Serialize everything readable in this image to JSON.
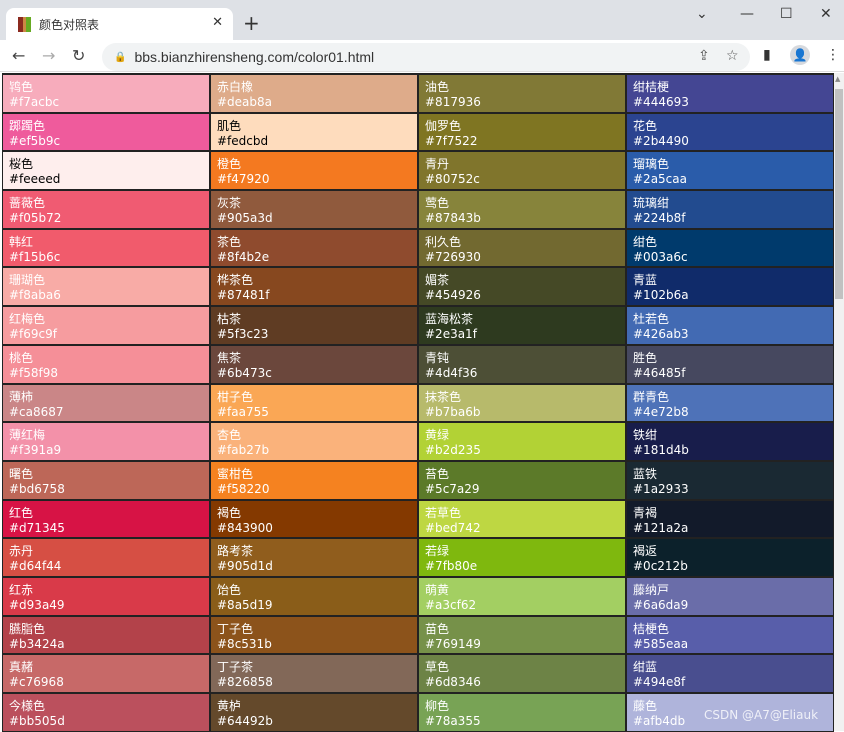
{
  "browser": {
    "tab_title": "颜色对照表",
    "url": "bbs.bianzhirensheng.com/color01.html"
  },
  "watermark": "CSDN @A7@Eliauk",
  "rows": [
    [
      {
        "name": "鸨色",
        "hex": "#f7acbc"
      },
      {
        "name": "赤白橡",
        "hex": "#deab8a"
      },
      {
        "name": "油色",
        "hex": "#817936"
      },
      {
        "name": "绀桔梗",
        "hex": "#444693"
      }
    ],
    [
      {
        "name": "踯躅色",
        "hex": "#ef5b9c"
      },
      {
        "name": "肌色",
        "hex": "#fedcbd"
      },
      {
        "name": "伽罗色",
        "hex": "#7f7522"
      },
      {
        "name": "花色",
        "hex": "#2b4490"
      }
    ],
    [
      {
        "name": "桜色",
        "hex": "#feeeed"
      },
      {
        "name": "橙色",
        "hex": "#f47920"
      },
      {
        "name": "青丹",
        "hex": "#80752c"
      },
      {
        "name": "瑠璃色",
        "hex": "#2a5caa"
      }
    ],
    [
      {
        "name": "蔷薇色",
        "hex": "#f05b72"
      },
      {
        "name": "灰茶",
        "hex": "#905a3d"
      },
      {
        "name": "莺色",
        "hex": "#87843b"
      },
      {
        "name": "琉璃绀",
        "hex": "#224b8f"
      }
    ],
    [
      {
        "name": "韩红",
        "hex": "#f15b6c"
      },
      {
        "name": "茶色",
        "hex": "#8f4b2e"
      },
      {
        "name": "利久色",
        "hex": "#726930"
      },
      {
        "name": "绀色",
        "hex": "#003a6c"
      }
    ],
    [
      {
        "name": "珊瑚色",
        "hex": "#f8aba6"
      },
      {
        "name": "桦茶色",
        "hex": "#87481f"
      },
      {
        "name": "媚茶",
        "hex": "#454926"
      },
      {
        "name": "青蓝",
        "hex": "#102b6a"
      }
    ],
    [
      {
        "name": "红梅色",
        "hex": "#f69c9f"
      },
      {
        "name": "枯茶",
        "hex": "#5f3c23"
      },
      {
        "name": "蓝海松茶",
        "hex": "#2e3a1f"
      },
      {
        "name": "杜若色",
        "hex": "#426ab3"
      }
    ],
    [
      {
        "name": "桃色",
        "hex": "#f58f98"
      },
      {
        "name": "焦茶",
        "hex": "#6b473c"
      },
      {
        "name": "青钝",
        "hex": "#4d4f36"
      },
      {
        "name": "胜色",
        "hex": "#46485f"
      }
    ],
    [
      {
        "name": "薄柿",
        "hex": "#ca8687"
      },
      {
        "name": "柑子色",
        "hex": "#faa755"
      },
      {
        "name": "抹茶色",
        "hex": "#b7ba6b"
      },
      {
        "name": "群青色",
        "hex": "#4e72b8"
      }
    ],
    [
      {
        "name": "薄红梅",
        "hex": "#f391a9"
      },
      {
        "name": "杏色",
        "hex": "#fab27b"
      },
      {
        "name": "黄绿",
        "hex": "#b2d235"
      },
      {
        "name": "铁绀",
        "hex": "#181d4b"
      }
    ],
    [
      {
        "name": "曙色",
        "hex": "#bd6758"
      },
      {
        "name": "蜜柑色",
        "hex": "#f58220"
      },
      {
        "name": "苔色",
        "hex": "#5c7a29"
      },
      {
        "name": "蓝铁",
        "hex": "#1a2933"
      }
    ],
    [
      {
        "name": "红色",
        "hex": "#d71345"
      },
      {
        "name": "褐色",
        "hex": "#843900"
      },
      {
        "name": "若草色",
        "hex": "#bed742"
      },
      {
        "name": "青褐",
        "hex": "#121a2a"
      }
    ],
    [
      {
        "name": "赤丹",
        "hex": "#d64f44"
      },
      {
        "name": "路考茶",
        "hex": "#905d1d"
      },
      {
        "name": "若绿",
        "hex": "#7fb80e"
      },
      {
        "name": "褐返",
        "hex": "#0c212b"
      }
    ],
    [
      {
        "name": "红赤",
        "hex": "#d93a49"
      },
      {
        "name": "饴色",
        "hex": "#8a5d19"
      },
      {
        "name": "萌黄",
        "hex": "#a3cf62"
      },
      {
        "name": "藤纳戸",
        "hex": "#6a6da9"
      }
    ],
    [
      {
        "name": "臙脂色",
        "hex": "#b3424a"
      },
      {
        "name": "丁子色",
        "hex": "#8c531b"
      },
      {
        "name": "苗色",
        "hex": "#769149"
      },
      {
        "name": "桔梗色",
        "hex": "#585eaa"
      }
    ],
    [
      {
        "name": "真赭",
        "hex": "#c76968"
      },
      {
        "name": "丁子茶",
        "hex": "#826858"
      },
      {
        "name": "草色",
        "hex": "#6d8346"
      },
      {
        "name": "绀蓝",
        "hex": "#494e8f"
      }
    ],
    [
      {
        "name": "今様色",
        "hex": "#bb505d"
      },
      {
        "name": "黄栌",
        "hex": "#64492b"
      },
      {
        "name": "柳色",
        "hex": "#78a355"
      },
      {
        "name": "藤色",
        "hex": "#afb4db"
      }
    ]
  ],
  "dark_text_colors": [
    "#feeeed",
    "#fedcbd"
  ]
}
